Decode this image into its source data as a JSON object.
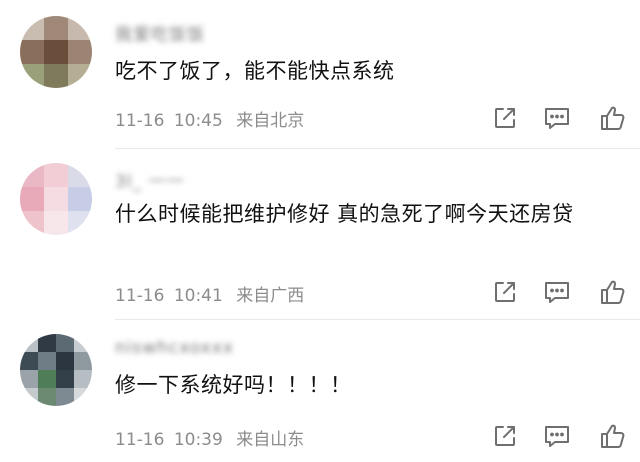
{
  "comments": [
    {
      "username": "我爱吃饭饭",
      "text": "吃不了饭了，能不能快点系统",
      "date": "11-16",
      "time": "10:45",
      "location": "来自北京"
    },
    {
      "username": "3l_ 一一",
      "text": "什么时候能把维护修好 真的急死了啊今天还房贷",
      "date": "11-16",
      "time": "10:41",
      "location": "来自广西"
    },
    {
      "username": "niswhcxoxxx",
      "text": "修一下系统好吗！！！！",
      "date": "11-16",
      "time": "10:39",
      "location": "来自山东"
    }
  ],
  "icons": {
    "share": "share-icon",
    "reply": "comment-icon",
    "like": "thumbs-up-icon"
  },
  "colors": {
    "text": "#111111",
    "meta": "#8c8c8c",
    "icon": "#6f6f6f",
    "divider": "#e9e9e9"
  }
}
